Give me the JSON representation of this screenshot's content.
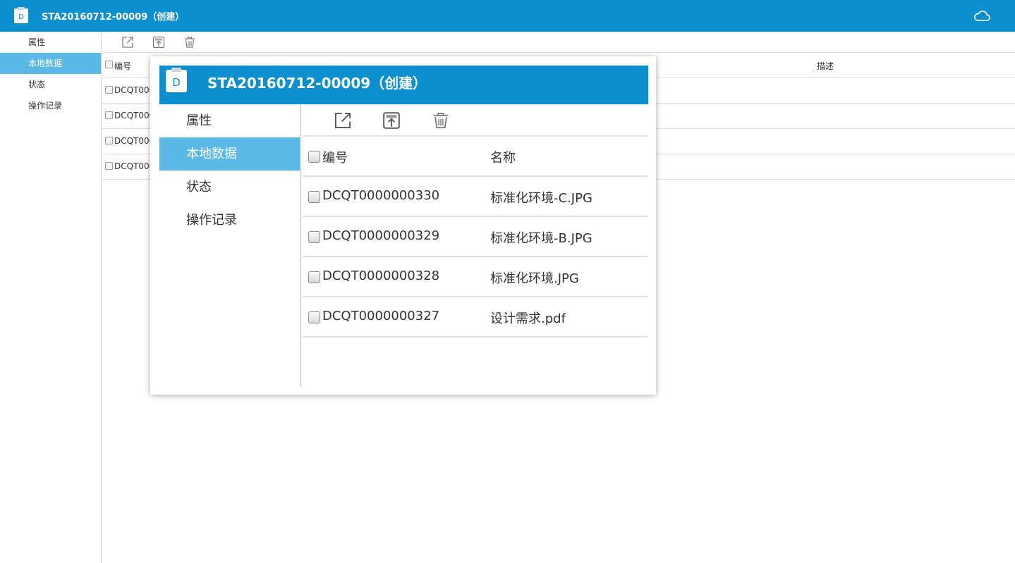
{
  "header": {
    "title": "STA20160712-00009（创建）"
  },
  "sidebar": {
    "items": [
      {
        "label": "属性"
      },
      {
        "label": "本地数据"
      },
      {
        "label": "状态"
      },
      {
        "label": "操作记录"
      }
    ],
    "active_index": 1
  },
  "toolbar": {
    "icons": [
      "external-link-icon",
      "upload-icon",
      "trash-icon"
    ]
  },
  "table": {
    "columns": [
      "编号",
      "名称",
      "描述"
    ],
    "rows": [
      {
        "id": "DCQT0000000330",
        "name": "标准化环境-C.JPG"
      },
      {
        "id": "DCQT0000000329",
        "name": "标准化环境-B.JPG"
      },
      {
        "id": "DCQT0000000328",
        "name": "标准化环境.JPG"
      },
      {
        "id": "DCQT0000000327",
        "name": "设计需求.pdf"
      }
    ],
    "background_visible_id_prefix": "DCQT000"
  },
  "colors": {
    "header": "#0b8fcf",
    "active_item": "#5cb8e6"
  },
  "icons": {
    "app": "document-d-icon",
    "cloud": "cloud-icon"
  }
}
